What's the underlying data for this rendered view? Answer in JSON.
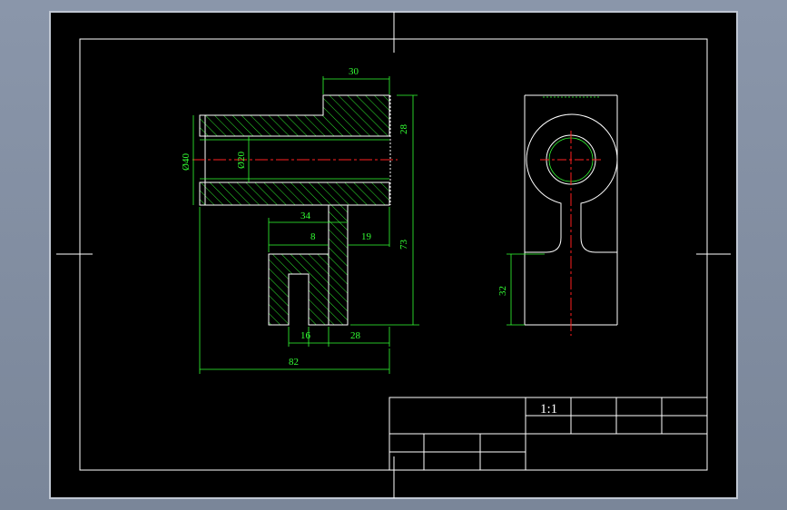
{
  "drawing": {
    "title_block": {
      "scale": "1:1"
    },
    "front_view": {
      "dimensions": {
        "top_width": "30",
        "top_height": "28",
        "outer_diameter": "Ø40",
        "bore_diameter": "Ø20",
        "width_34": "34",
        "width_8": "8",
        "width_19": "19",
        "total_height": "73",
        "slot_width": "16",
        "right_28": "28",
        "total_length": "82"
      }
    },
    "side_view": {
      "dimensions": {
        "lower_height": "32"
      }
    }
  },
  "colors": {
    "background": "#000000",
    "frame": "#ffffff",
    "dimension": "#33ff33",
    "hatch": "#33ff33",
    "centerline": "#ff2020",
    "outline": "#ffffff",
    "workspace": "#8a96aa"
  }
}
